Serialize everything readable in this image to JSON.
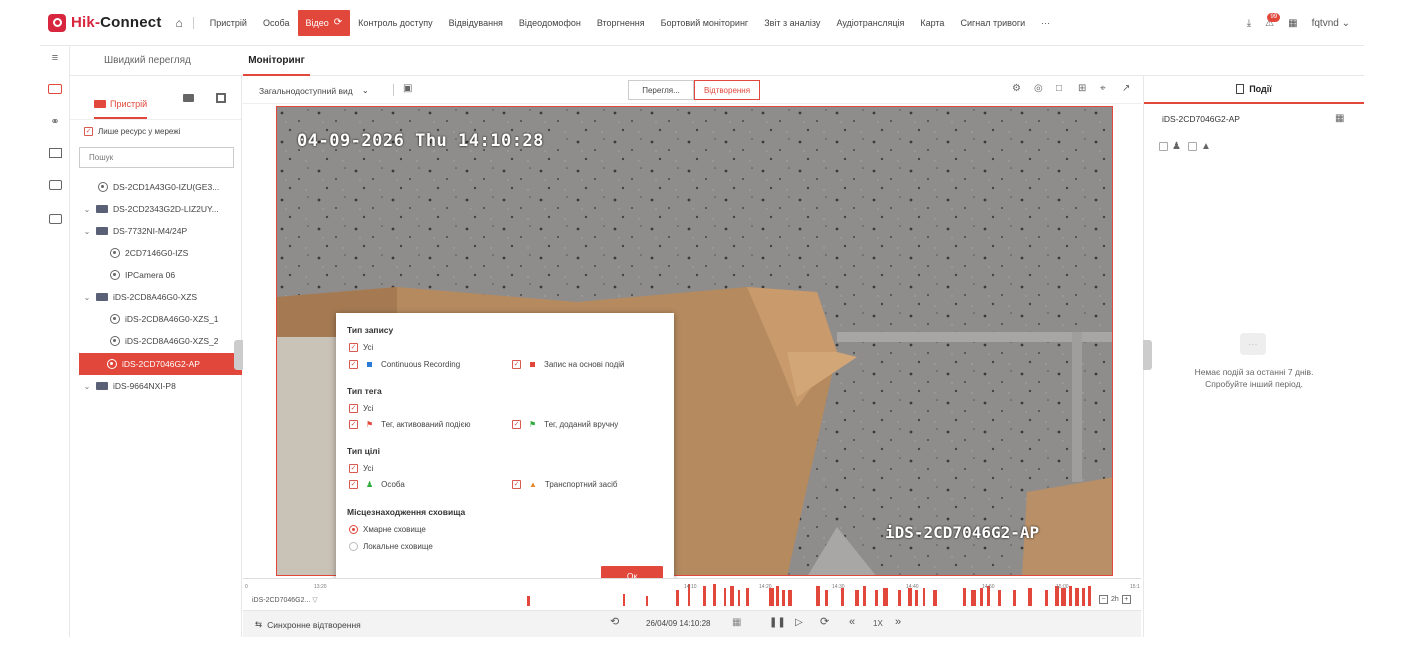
{
  "app": {
    "brand_main": "Hik-",
    "brand_rest": "Connect"
  },
  "nav": [
    {
      "label": "Пристрій"
    },
    {
      "label": "Особа"
    },
    {
      "label": "Відео"
    },
    {
      "label": "Контроль доступу"
    },
    {
      "label": "Відвідування"
    },
    {
      "label": "Відеодомофон"
    },
    {
      "label": "Вторгнення"
    },
    {
      "label": "Бортовий моніторинг"
    },
    {
      "label": "Звіт з аналізу"
    },
    {
      "label": "Аудіотрансляція"
    },
    {
      "label": "Карта"
    },
    {
      "label": "Сигнал тривоги"
    },
    {
      "label": "···"
    }
  ],
  "top_right": {
    "notification_count": "99",
    "username": "fqtvnd"
  },
  "tabs": [
    {
      "label": "Швидкий перегляд"
    },
    {
      "label": "Моніторинг"
    }
  ],
  "device_panel": {
    "tab_label": "Пристрій",
    "online_only_label": "Лише ресурс у мережі",
    "search_placeholder": "Пошук",
    "items": [
      {
        "label": "DS-2CD1A43G0-IZU(GE3..."
      },
      {
        "label": "DS-2CD2343G2D-LIZ2UY..."
      },
      {
        "label": "DS-7732NI-M4/24P"
      },
      {
        "label": "2CD7146G0-IZS"
      },
      {
        "label": "IPCamera 06"
      },
      {
        "label": "iDS-2CD8A46G0-XZS"
      },
      {
        "label": "iDS-2CD8A46G0-XZS_1"
      },
      {
        "label": "iDS-2CD8A46G0-XZS_2"
      },
      {
        "label": "iDS-2CD7046G2-AP"
      },
      {
        "label": "iDS-9664NXI-P8"
      }
    ]
  },
  "toolbar": {
    "view_label": "Загальнодоступний вид",
    "liveview_label": "Перегля...",
    "playback_label": "Відтворення"
  },
  "video": {
    "osd_time": "04-09-2026 Thu 14:10:28",
    "osd_camera": "iDS-2CD7046G2-AP"
  },
  "filter": {
    "record_type_title": "Тип запису",
    "all_label": "Усі",
    "continuous_label": "Continuous Recording",
    "event_record_label": "Запис на основі подій",
    "tag_type_title": "Тип тега",
    "tag_event_label": "Тег, активований подією",
    "tag_manual_label": "Тег, доданий вручну",
    "target_type_title": "Тип цілі",
    "person_label": "Особа",
    "vehicle_label": "Транспортний засіб",
    "storage_title": "Місцезнаходження сховища",
    "cloud_label": "Хмарне сховище",
    "local_label": "Локальне сховище",
    "ok_label": "Ок",
    "colors": {
      "continuous": "#2a7ad6",
      "event": "#e2473b",
      "tag_event": "#e2473b",
      "tag_manual": "#2eaa3a",
      "person": "#2eaa3a",
      "vehicle": "#e0882a"
    }
  },
  "timeline": {
    "camera_label": "iDS-2CD7046G2...",
    "ticks": [
      "0",
      "13:20",
      "14:10",
      "14:20",
      "14:30",
      "14:40",
      "14:50",
      "15:00",
      "15:1"
    ],
    "zoom_label": "2h"
  },
  "bottom": {
    "sync_label": "Синхронне відтворення",
    "datetime": "26/04/09 14:10:28",
    "speed": "1X"
  },
  "right_panel": {
    "title": "Події",
    "camera_select": "iDS-2CD7046G2-AP",
    "empty_text": "Немає подій за останні 7 днів. Спробуйте інший період."
  }
}
